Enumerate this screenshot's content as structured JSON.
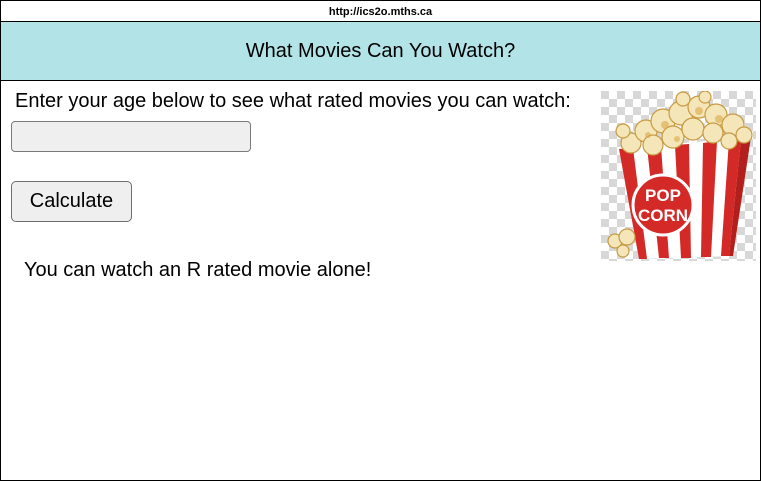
{
  "url": "http://ics2o.mths.ca",
  "header": {
    "title": "What Movies Can You Watch?",
    "background": "#b2e3e6"
  },
  "main": {
    "prompt": "Enter your age below to see what rated movies you can watch:",
    "age_input": {
      "value": "",
      "placeholder": ""
    },
    "calculate_label": "Calculate",
    "result": "You can watch an R rated movie alone!"
  },
  "image": {
    "icon": "popcorn-icon",
    "lettering": [
      "POP",
      "CORN"
    ],
    "colors": {
      "stripe_red": "#d42a27",
      "stripe_white": "#ffffff",
      "kernel": "#f4e6b8"
    }
  }
}
